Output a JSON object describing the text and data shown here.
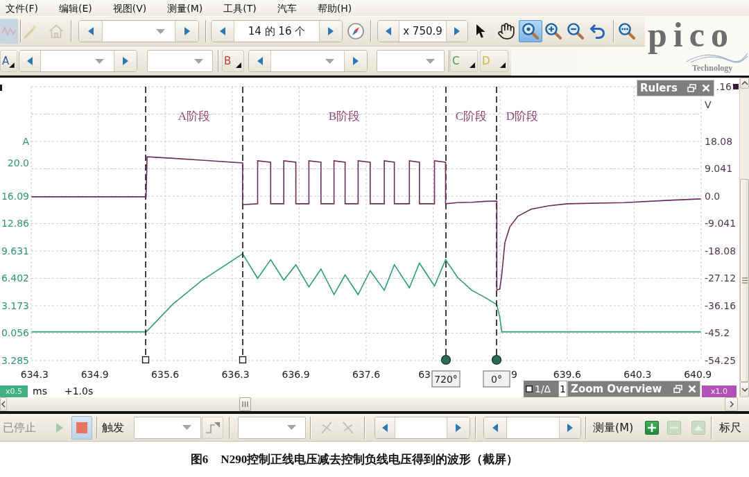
{
  "menu": [
    "文件(F)",
    "编辑(E)",
    "视图(V)",
    "测量(M)",
    "工具(T)",
    "汽车",
    "帮助(H)"
  ],
  "toolbar": {
    "quick_tools": [
      {
        "kind": "waveform",
        "disabled": true
      },
      {
        "kind": "wand",
        "disabled": true
      },
      {
        "kind": "home",
        "disabled": true
      }
    ],
    "page_counter": "14 的 16 个",
    "zoom_factor": "x 750.9",
    "mouse_tools": [
      {
        "kind": "pointer",
        "selected": false
      },
      {
        "kind": "hand",
        "selected": false
      },
      {
        "kind": "zoom-area",
        "selected": true
      },
      {
        "kind": "zoom-in",
        "selected": false
      },
      {
        "kind": "zoom-out",
        "selected": false
      }
    ]
  },
  "logo": {
    "wordmark": "pico",
    "tagline": "Technology"
  },
  "channels": [
    {
      "label": "A",
      "color": "#2d5ea8",
      "kind": "full"
    },
    {
      "label": "B",
      "color": "#d03a3a",
      "kind": "full"
    },
    {
      "label": "C",
      "color": "#3ea052",
      "kind": "compact"
    },
    {
      "label": "D",
      "color": "#d2b640",
      "kind": "compact"
    }
  ],
  "scope": {
    "stage_labels": [
      "A阶段",
      "B阶段",
      "C阶段",
      "D阶段"
    ],
    "current_plot": {
      "chart_data": {
        "type": "line",
        "ylabel": "A",
        "grid": true,
        "x": [
          634.27,
          635.41,
          635.42,
          635.68,
          635.96,
          636.37,
          636.37,
          636.52,
          636.52,
          636.65,
          636.65,
          636.78,
          636.78,
          636.9,
          636.9,
          637.03,
          637.03,
          637.15,
          637.15,
          637.28,
          637.28,
          637.39,
          637.39,
          637.52,
          637.52,
          637.64,
          637.64,
          637.78,
          637.78,
          637.88,
          637.88,
          638.03,
          638.03,
          638.13,
          638.13,
          638.28,
          638.28,
          638.39,
          638.39,
          638.51,
          638.65,
          638.79,
          638.9,
          638.9,
          638.93,
          638.95,
          638.98,
          639.03,
          639.11,
          639.24,
          639.41,
          639.6,
          640.17,
          640.58,
          640.93
        ],
        "series": [
          {
            "color": "#2f9a7a",
            "values": [
              0.1,
              0.1,
              0.2,
              3.4,
              6.1,
              9.3,
              9.3,
              6.4,
              6.4,
              8.6,
              8.6,
              6.2,
              6.2,
              8.0,
              8.0,
              5.4,
              5.4,
              7.5,
              7.5,
              4.5,
              4.5,
              6.8,
              6.8,
              4.5,
              4.5,
              7.3,
              7.3,
              5.0,
              5.0,
              8.0,
              8.0,
              5.3,
              5.3,
              8.2,
              8.2,
              5.5,
              5.5,
              8.6,
              8.6,
              6.5,
              5.0,
              4.1,
              3.3,
              3.3,
              1.8,
              0.1,
              0.1,
              0.1,
              0.1,
              0.1,
              0.1,
              0.1,
              0.1,
              0.1,
              0.1
            ]
          }
        ],
        "xlim": [
          634.267,
          640.933
        ],
        "ylim": [
          -3.285,
          29.0
        ],
        "xticks": [
          634.3,
          634.9,
          635.6,
          636.3,
          636.9,
          637.6,
          639.6,
          640.3,
          640.9
        ],
        "yticks": [
          {
            "value": 20.0,
            "label": "20.0"
          },
          16.09,
          12.86,
          9.631,
          6.402,
          3.173,
          {
            "value": -0.056,
            "label": "0.056"
          },
          {
            "value": -3.285,
            "label": "3.285"
          }
        ]
      },
      "covered_labels": [
        "63",
        "9"
      ]
    },
    "voltage_plot": {
      "chart_data": {
        "type": "line",
        "ylabel": "V",
        "x": [
          634.27,
          635.41,
          635.42,
          635.68,
          635.96,
          636.37,
          636.37,
          636.52,
          636.52,
          636.65,
          636.65,
          636.78,
          636.78,
          636.9,
          636.9,
          637.03,
          637.03,
          637.15,
          637.15,
          637.28,
          637.28,
          637.39,
          637.39,
          637.52,
          637.52,
          637.64,
          637.64,
          637.78,
          637.78,
          637.88,
          637.88,
          638.03,
          638.03,
          638.13,
          638.13,
          638.28,
          638.28,
          638.39,
          638.39,
          638.51,
          638.65,
          638.79,
          638.9,
          638.9,
          638.93,
          638.95,
          638.98,
          639.03,
          639.11,
          639.24,
          639.41,
          639.6,
          640.17,
          640.58,
          640.93
        ],
        "series": [
          {
            "color": "#6b2b60",
            "values": [
              -0.2,
              -0.2,
              13.0,
              12.5,
              11.9,
              11.0,
              -2.8,
              -2.5,
              11.7,
              11.2,
              -2.5,
              -2.5,
              11.7,
              11.2,
              -2.5,
              -2.5,
              11.7,
              11.2,
              -2.5,
              -2.5,
              11.7,
              11.2,
              -2.5,
              -2.5,
              11.7,
              11.2,
              -2.5,
              -2.5,
              11.7,
              11.2,
              -2.5,
              -2.5,
              11.7,
              11.2,
              -2.5,
              -2.5,
              11.7,
              11.2,
              -2.5,
              -2.1,
              -2.0,
              -1.7,
              -1.6,
              -30.9,
              -30.7,
              -25.6,
              -15.3,
              -10.1,
              -6.6,
              -4.3,
              -3.2,
              -2.5,
              -2.1,
              -1.4,
              -0.9
            ]
          }
        ],
        "xlim": [
          634.267,
          640.933
        ],
        "ylim": [
          -54.25,
          36.16
        ],
        "yticks": [
          18.08,
          9.041,
          {
            "value": 0,
            "label": "0.0"
          },
          -9.041,
          -18.08,
          -27.12,
          -36.16,
          -45.2,
          -54.25
        ]
      },
      "covered_label": ".16"
    },
    "cursors": [
      {
        "kind": "time"
      },
      {
        "kind": "time"
      },
      {
        "kind": "phase",
        "tag": "720°"
      },
      {
        "kind": "phase",
        "tag": "0°"
      }
    ],
    "rulers_panel": {
      "title": "Rulers"
    },
    "bottom_bar": {
      "x_zoom": "x0.5",
      "time_unit": "ms",
      "time_offset": "+1.0s",
      "ruler_label": "1/Δ",
      "ruler_value": "1",
      "zoom_overview_title": "Zoom Overview",
      "y_zoom": "x1.0"
    }
  },
  "bottom_toolbar": {
    "status": "已停止",
    "run_controls": [
      {
        "kind": "start",
        "selected": false
      },
      {
        "kind": "stop",
        "selected": true
      }
    ],
    "trigger_label": "触发",
    "measure_label": "测量(M)",
    "measure_buttons": [
      {
        "kind": "add",
        "disabled": false
      },
      {
        "kind": "remove",
        "disabled": true
      },
      {
        "kind": "edit",
        "disabled": true
      }
    ],
    "ruler_label": "标尺"
  },
  "caption": {
    "number": "图6",
    "text": "N290控制正线电压减去控制负线电压得到的波形（截屏）"
  }
}
